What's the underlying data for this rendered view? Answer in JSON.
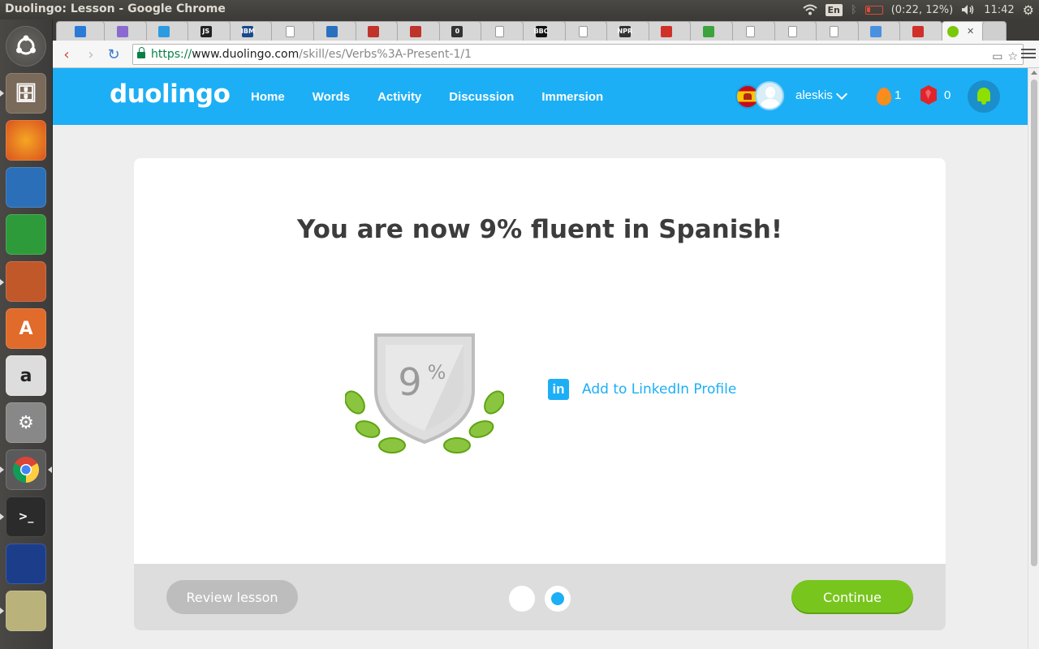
{
  "os": {
    "window_title": "Duolingo: Lesson - Google Chrome",
    "keyboard_layout": "En",
    "battery": "(0:22, 12%)",
    "clock": "11:42"
  },
  "browser": {
    "url_scheme": "https://",
    "url_host": "www.duolingo.com",
    "url_path": "/skill/es/Verbs%3A-Present-1/1",
    "tab_favicons": [
      {
        "icon": "blue-diamond-icon",
        "color": "#2a7ad8",
        "text": ""
      },
      {
        "icon": "colorful-circle-icon",
        "color": "#8a6ad0",
        "text": ""
      },
      {
        "icon": "smiley-icon",
        "color": "#2d9be0",
        "text": ""
      },
      {
        "icon": "js-icon",
        "color": "#222222",
        "text": "JS"
      },
      {
        "icon": "ibm-icon",
        "color": "#1a4a8a",
        "text": "IBM"
      },
      {
        "icon": "document-icon",
        "color": "#ffffff",
        "text": ""
      },
      {
        "icon": "network-icon",
        "color": "#2a70c0",
        "text": ""
      },
      {
        "icon": "opera-icon",
        "color": "#c0332a",
        "text": ""
      },
      {
        "icon": "opera-icon",
        "color": "#c0332a",
        "text": ""
      },
      {
        "icon": "zero-icon",
        "color": "#333333",
        "text": "0"
      },
      {
        "icon": "document-icon",
        "color": "#ffffff",
        "text": ""
      },
      {
        "icon": "bbc-icon",
        "color": "#111111",
        "text": "BBC"
      },
      {
        "icon": "document-icon",
        "color": "#ffffff",
        "text": ""
      },
      {
        "icon": "npr-icon",
        "color": "#333333",
        "text": "NPR"
      },
      {
        "icon": "red-bird-icon",
        "color": "#d0302a",
        "text": ""
      },
      {
        "icon": "green-leaf-icon",
        "color": "#3da33d",
        "text": ""
      },
      {
        "icon": "document-icon",
        "color": "#ffffff",
        "text": ""
      },
      {
        "icon": "document-icon",
        "color": "#ffffff",
        "text": ""
      },
      {
        "icon": "document-icon",
        "color": "#ffffff",
        "text": ""
      },
      {
        "icon": "blue-star-icon",
        "color": "#4a90e0",
        "text": ""
      },
      {
        "icon": "gmail-icon",
        "color": "#d0302a",
        "text": ""
      }
    ],
    "active_tab_icon": "duolingo-owl-icon"
  },
  "duolingo": {
    "logo": "duolingo",
    "nav": [
      "Home",
      "Words",
      "Activity",
      "Discussion",
      "Immersion"
    ],
    "username": "aleskis",
    "streak": "1",
    "gems": "0",
    "brand_blue": "#1caff6",
    "brand_green": "#78c51e"
  },
  "lesson": {
    "headline": "You are now 9% fluent in Spanish!",
    "badge_number": "9",
    "badge_percent_sign": "%",
    "linkedin_label": "Add to LinkedIn Profile",
    "linkedin_logo": "in",
    "review_button": "Review lesson",
    "continue_button": "Continue",
    "progress_dots": 2,
    "current_dot": 2
  }
}
